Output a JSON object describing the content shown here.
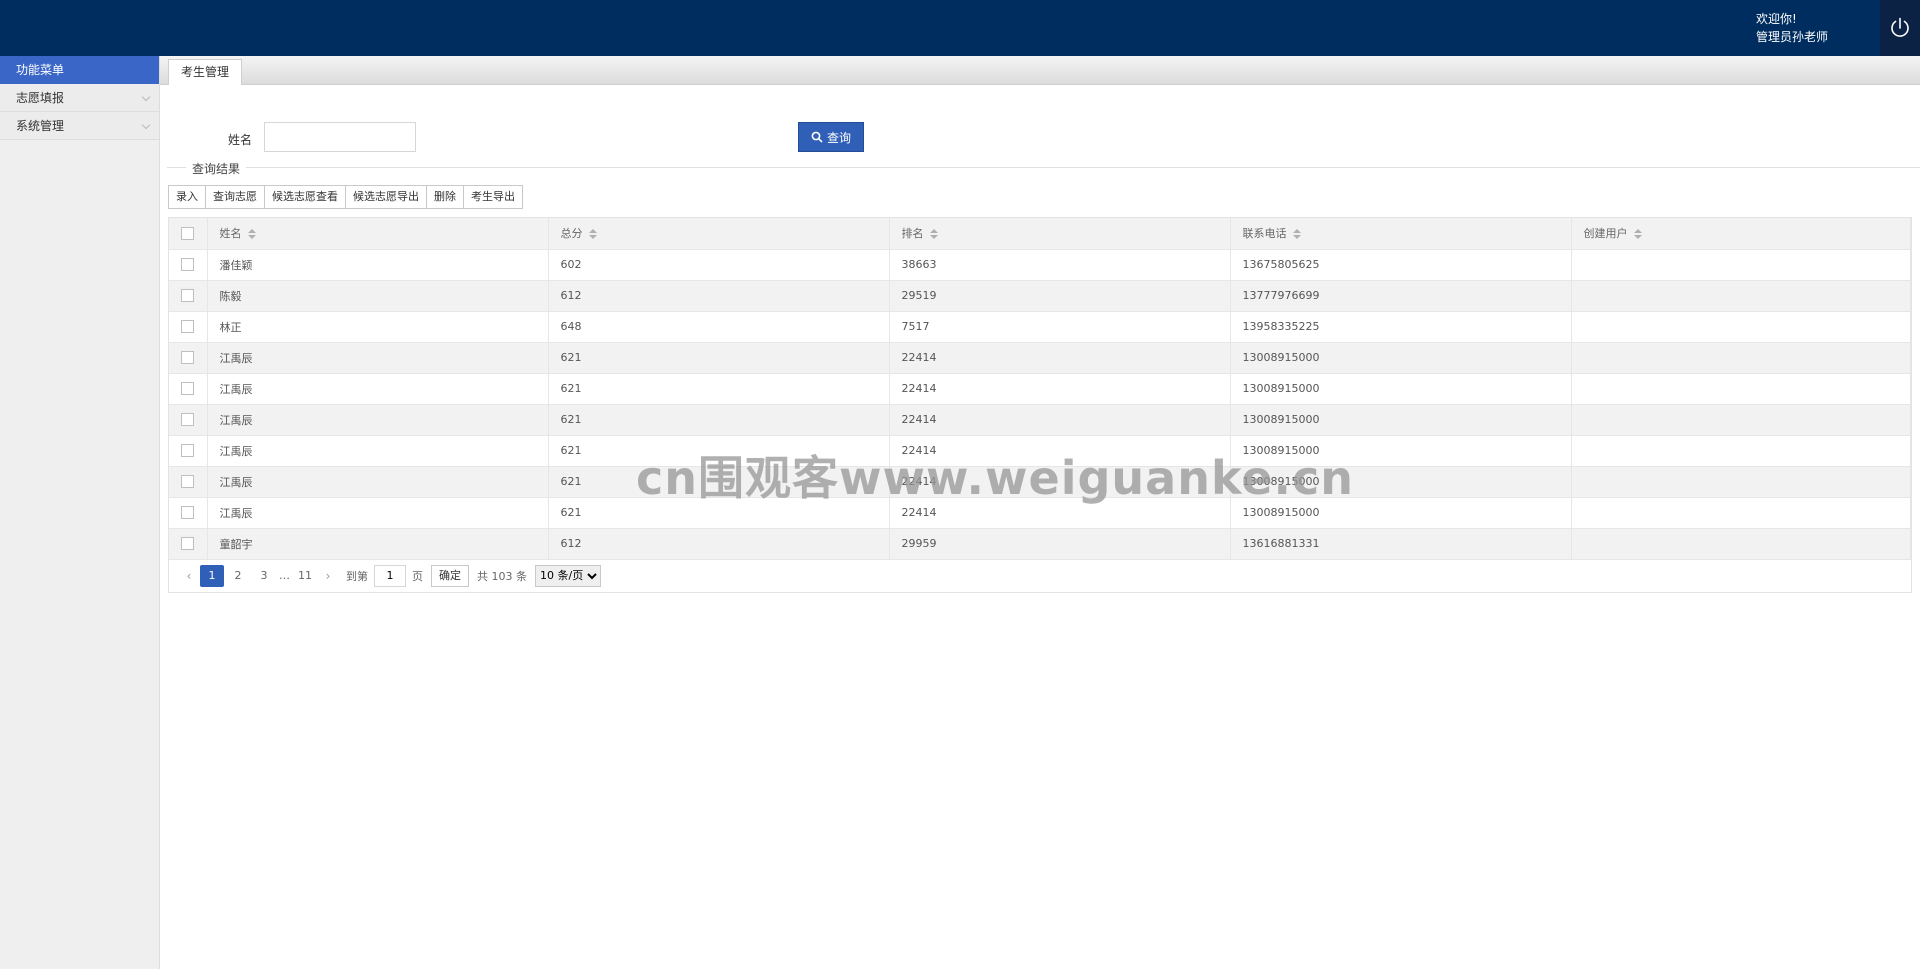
{
  "header": {
    "welcome_line1": "欢迎你!",
    "welcome_line2": "管理员孙老师",
    "bg_color": "#002d5f"
  },
  "sidebar": {
    "title": "功能菜单",
    "items": [
      {
        "label": "志愿填报"
      },
      {
        "label": "系统管理"
      }
    ]
  },
  "tabs": [
    {
      "label": "考生管理",
      "active": true
    }
  ],
  "search": {
    "name_label": "姓名",
    "name_value": "",
    "button_label": "查询"
  },
  "results": {
    "legend": "查询结果"
  },
  "toolbar": {
    "buttons": [
      "录入",
      "查询志愿",
      "候选志愿查看",
      "候选志愿导出",
      "删除",
      "考生导出"
    ]
  },
  "table": {
    "columns": [
      "姓名",
      "总分",
      "排名",
      "联系电话",
      "创建用户"
    ],
    "rows": [
      [
        "潘佳颖",
        "602",
        "38663",
        "13675805625",
        ""
      ],
      [
        "陈毅",
        "612",
        "29519",
        "13777976699",
        ""
      ],
      [
        "林正",
        "648",
        "7517",
        "13958335225",
        ""
      ],
      [
        "江禹辰",
        "621",
        "22414",
        "13008915000",
        ""
      ],
      [
        "江禹辰",
        "621",
        "22414",
        "13008915000",
        ""
      ],
      [
        "江禹辰",
        "621",
        "22414",
        "13008915000",
        ""
      ],
      [
        "江禹辰",
        "621",
        "22414",
        "13008915000",
        ""
      ],
      [
        "江禹辰",
        "621",
        "22414",
        "13008915000",
        ""
      ],
      [
        "江禹辰",
        "621",
        "22414",
        "13008915000",
        ""
      ],
      [
        "童韶宇",
        "612",
        "29959",
        "13616881331",
        ""
      ]
    ]
  },
  "pagination": {
    "pages": [
      "1",
      "2",
      "3"
    ],
    "ellipsis": "…",
    "last_page": "11",
    "goto_label": "到第",
    "goto_value": "1",
    "page_unit": "页",
    "confirm_label": "确定",
    "total_label": "共 103 条",
    "page_size": "10 条/页"
  },
  "watermark": "cn围观客www.weiguanke.cn",
  "colors": {
    "primary": "#2f5fb6",
    "sidebar_active": "#3a67c7"
  }
}
